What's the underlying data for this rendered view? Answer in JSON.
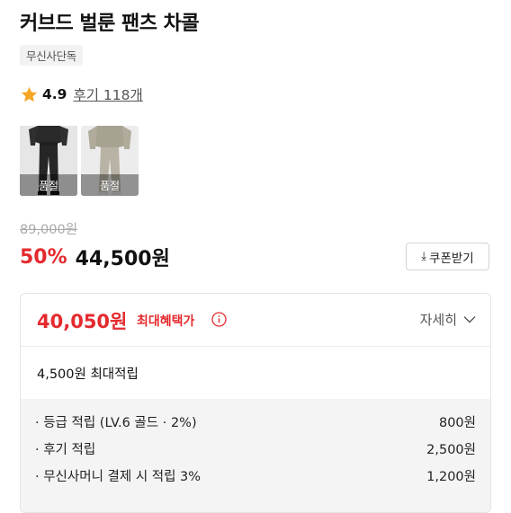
{
  "product": {
    "title": "커브드 벌룬 팬츠 차콜",
    "badge": "무신사단독"
  },
  "rating": {
    "score": "4.9",
    "reviews_label": "후기 118개",
    "star_color": "#f5a623"
  },
  "options": [
    {
      "color_name": "차콜",
      "status": "품절",
      "selected": true
    },
    {
      "color_name": "베이지",
      "status": "품절",
      "selected": false
    }
  ],
  "pricing": {
    "original": "89,000원",
    "discount": "50%",
    "sale": "44,500원",
    "coupon_button": "쿠폰받기",
    "accent_color": "#e42a2e"
  },
  "benefit": {
    "best_price": "40,050원",
    "best_label": "최대혜택가",
    "detail_label": "자세히",
    "max_points": "4,500원 최대적립",
    "breakdown": [
      {
        "label": "· 등급 적립 (LV.6 골드 · 2%)",
        "value": "800원"
      },
      {
        "label": "· 후기 적립",
        "value": "2,500원"
      },
      {
        "label": "· 무신사머니 결제 시 적립 3%",
        "value": "1,200원"
      }
    ]
  }
}
